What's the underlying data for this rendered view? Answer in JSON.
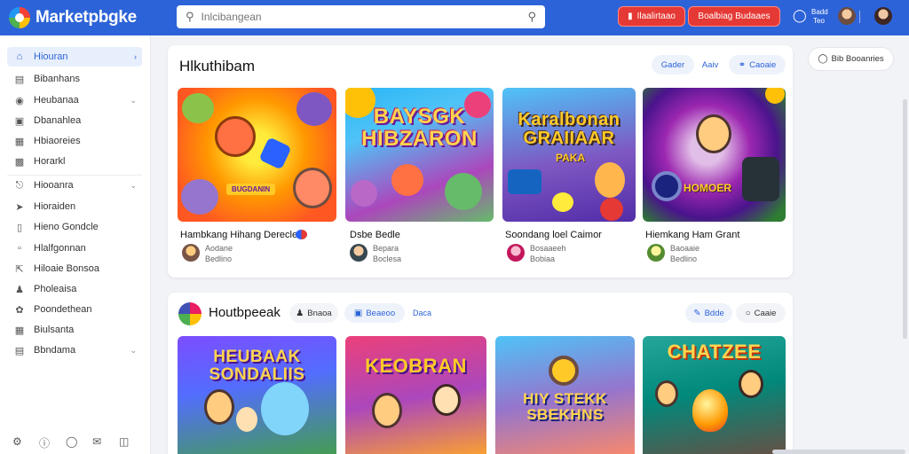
{
  "app": {
    "name": "Marketpbgke"
  },
  "search": {
    "placeholder": "Inlcibangean"
  },
  "topbar": {
    "btn1_label": "Ilaalirtaao",
    "btn2_label": "Boalbiag Budaaes",
    "status_label": "Badd",
    "status_sub": "Teo"
  },
  "sidebar": {
    "items": [
      {
        "label": "Hiouran",
        "icon": "home-icon",
        "chevron": "›"
      },
      {
        "label": "Bibanhans",
        "icon": "doc-icon"
      },
      {
        "label": "Heubanaa",
        "icon": "circle-icon",
        "chevron": "⌄"
      },
      {
        "label": "Dbanahlea",
        "icon": "folder-icon"
      },
      {
        "label": "Hbiaoreies",
        "icon": "file-icon"
      },
      {
        "label": "Horarkl",
        "icon": "box-icon"
      },
      {
        "label": "Hiooanra",
        "icon": "tag-icon",
        "chevron": "⌄"
      },
      {
        "label": "Hioraiden",
        "icon": "pin-icon"
      },
      {
        "label": "Hieno Gondcle",
        "icon": "phone-icon"
      },
      {
        "label": "Hlalfgonnan",
        "icon": "book-icon"
      },
      {
        "label": "Hiloaie Bonsoa",
        "icon": "share-icon"
      },
      {
        "label": "Pholeaisa",
        "icon": "user-icon"
      },
      {
        "label": "Poondethean",
        "icon": "leaf-icon"
      },
      {
        "label": "Biulsanta",
        "icon": "grid-icon"
      },
      {
        "label": "Bbndama",
        "icon": "list-icon",
        "chevron": "⌄"
      }
    ]
  },
  "section1": {
    "title": "Hlkuthibam",
    "pills": [
      "Gader",
      "Aaiv",
      "Caoaie"
    ],
    "cards": [
      {
        "art_title": "",
        "art_badge": "BUGDANIN",
        "name": "Hambkang Hihang Derecle",
        "sub1": "Aodane",
        "sub2": "Bedlino"
      },
      {
        "art_title": "BAYSGK HIBZARON",
        "art_badge": "",
        "name": "Dsbe Bedle",
        "sub1": "Bepara",
        "sub2": "Boclesa"
      },
      {
        "art_title": "Karalbonan GRAIIAAR",
        "art_badge": "PAKA",
        "name": "Soondang loel Caimor",
        "sub1": "Bosaaeeh",
        "sub2": "Bobiaa"
      },
      {
        "art_title": "",
        "art_badge": "HOMOER",
        "name": "Hiemkang Ham Grant",
        "sub1": "Baoaaie",
        "sub2": "Bedlino"
      }
    ]
  },
  "section2": {
    "title": "Houtbpeeak",
    "pills": [
      "Bnaoa",
      "Beaeoo",
      "Daca",
      "Bdde",
      "Caaie"
    ],
    "cards": [
      {
        "art_title": "HEUBAAK SONDALIIS"
      },
      {
        "art_title": "KEOBRAN"
      },
      {
        "art_title": "HIY STEKK SBEKHNS"
      },
      {
        "art_title": "CHATZEE"
      }
    ]
  },
  "right_panel": {
    "btn_label": "Bib Booanries"
  },
  "colors": {
    "brand": "#2d63d8",
    "danger": "#e53935",
    "accent": "#ffd54f"
  }
}
